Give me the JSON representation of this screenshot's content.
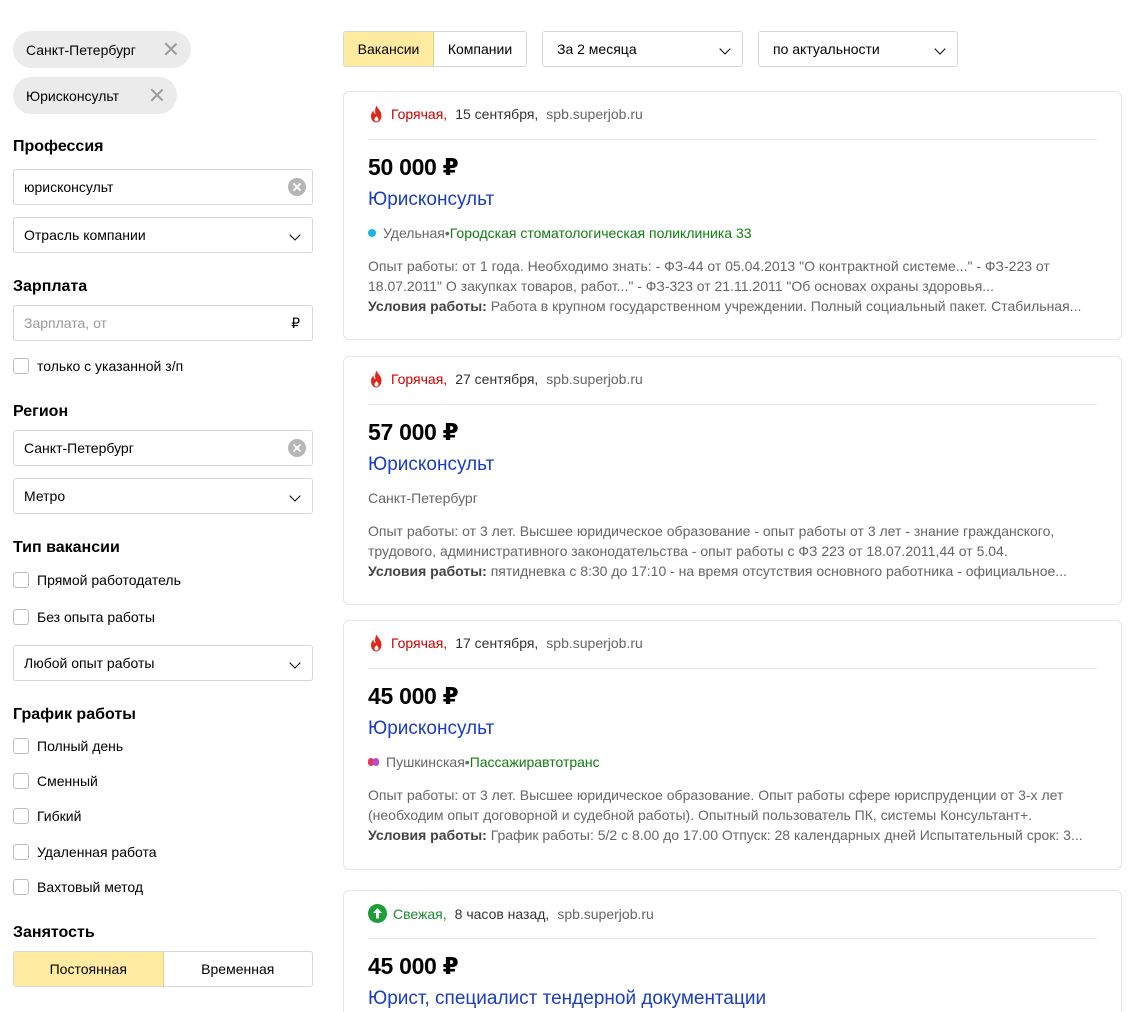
{
  "sidebar": {
    "chips": [
      "Санкт-Петербург",
      "Юрисконсульт"
    ],
    "profession": {
      "title": "Профессия",
      "value": "юрисконсульт",
      "industry": "Отрасль компании"
    },
    "salary": {
      "title": "Зарплата",
      "placeholder": "Зарплата, от",
      "currency": "₽",
      "only_with_salary": "только с указанной з/п"
    },
    "region": {
      "title": "Регион",
      "value": "Санкт-Петербург",
      "metro": "Метро"
    },
    "vacancy_type": {
      "title": "Тип вакансии",
      "options": [
        "Прямой работодатель",
        "Без опыта работы"
      ],
      "experience": "Любой опыт работы"
    },
    "schedule": {
      "title": "График работы",
      "options": [
        "Полный день",
        "Сменный",
        "Гибкий",
        "Удаленная работа",
        "Вахтовый метод"
      ]
    },
    "employment": {
      "title": "Занятость",
      "options": [
        "Постоянная",
        "Временная"
      ],
      "active": "Постоянная"
    }
  },
  "topbar": {
    "tabs": [
      "Вакансии",
      "Компании"
    ],
    "active_tab": "Вакансии",
    "period": "За 2 месяца",
    "sort": "по актуальности"
  },
  "cards": [
    {
      "tag": "Горячая,",
      "tag_type": "hot",
      "date": "15 сентября,",
      "source": "spb.superjob.ru",
      "salary": "50 000 ₽",
      "title": "Юрисконсульт",
      "location": "Удельная",
      "location_sep": " • ",
      "company": "Городская стоматологическая поликлиника 33",
      "desc1": "Опыт работы: от 1 года. Необходимо знать: - ФЗ-44 от 05.04.2013 \"О контрактной системе...\" - ФЗ-223 от",
      "desc2": "18.07.2011\" О закупках товаров, работ...\" - ФЗ-323 от 21.11.2011 \"Об основах охраны здоровья...",
      "cond_label": "Условия работы:",
      "cond": " Работа в крупном государственном учреждении. Полный социальный пакет. Стабильная..."
    },
    {
      "tag": "Горячая,",
      "tag_type": "hot",
      "date": "27 сентября,",
      "source": "spb.superjob.ru",
      "salary": "57 000 ₽",
      "title": "Юрисконсульт",
      "location": "Санкт-Петербург",
      "desc1": "Опыт работы: от 3 лет. Высшее юридическое образование - опыт работы от 3 лет - знание гражданского,",
      "desc2": "трудового, административного законодательства - опыт работы с ФЗ 223 от 18.07.2011,44 от 5.04.",
      "cond_label": "Условия работы:",
      "cond": " пятидневка с 8:30 до 17:10 - на время отсутствия основного работника - официальное..."
    },
    {
      "tag": "Горячая,",
      "tag_type": "hot",
      "date": "17 сентября,",
      "source": "spb.superjob.ru",
      "salary": "45 000 ₽",
      "title": "Юрисконсульт",
      "location": "Пушкинская",
      "location_sep": " • ",
      "company": "Пассажиравтотранс",
      "desc1": "Опыт работы: от 3 лет. Высшее юридическое образование. Опыт работы сфере юриспруденции от 3-х лет",
      "desc2": "(необходим опыт договорной и судебной работы). Опытный пользователь ПК, системы Консультант+.",
      "cond_label": "Условия работы:",
      "cond": " График работы: 5/2 с 8.00 до 17.00 Отпуск: 28 календарных дней Испытательный срок: 3..."
    },
    {
      "tag": "Свежая,",
      "tag_type": "fresh",
      "date": "8 часов назад,",
      "source": "spb.superjob.ru",
      "salary": "45 000 ₽",
      "title": "Юрист, специалист тендерной документации"
    }
  ],
  "colors": {
    "accent_yellow": "#ffeba0",
    "link_blue": "#1a3dc1",
    "hot_red": "#cc0000",
    "fresh_green": "#1c8a2e",
    "company_green": "#107d10",
    "metro_blue": "#1eb4e6"
  }
}
